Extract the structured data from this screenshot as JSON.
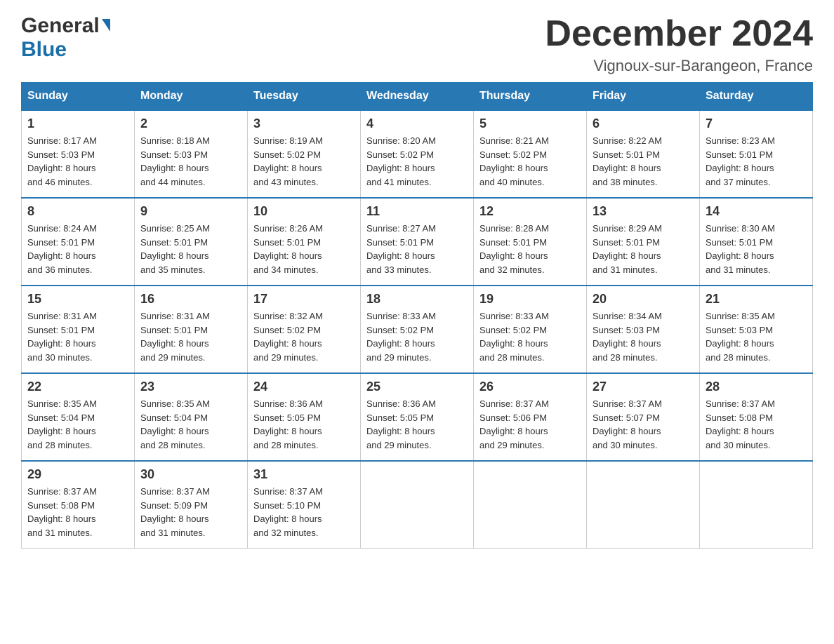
{
  "header": {
    "logo_general": "General",
    "logo_blue": "Blue",
    "month_title": "December 2024",
    "location": "Vignoux-sur-Barangeon, France"
  },
  "days_of_week": [
    "Sunday",
    "Monday",
    "Tuesday",
    "Wednesday",
    "Thursday",
    "Friday",
    "Saturday"
  ],
  "weeks": [
    [
      {
        "day": "1",
        "sunrise": "8:17 AM",
        "sunset": "5:03 PM",
        "daylight": "8 hours and 46 minutes."
      },
      {
        "day": "2",
        "sunrise": "8:18 AM",
        "sunset": "5:03 PM",
        "daylight": "8 hours and 44 minutes."
      },
      {
        "day": "3",
        "sunrise": "8:19 AM",
        "sunset": "5:02 PM",
        "daylight": "8 hours and 43 minutes."
      },
      {
        "day": "4",
        "sunrise": "8:20 AM",
        "sunset": "5:02 PM",
        "daylight": "8 hours and 41 minutes."
      },
      {
        "day": "5",
        "sunrise": "8:21 AM",
        "sunset": "5:02 PM",
        "daylight": "8 hours and 40 minutes."
      },
      {
        "day": "6",
        "sunrise": "8:22 AM",
        "sunset": "5:01 PM",
        "daylight": "8 hours and 38 minutes."
      },
      {
        "day": "7",
        "sunrise": "8:23 AM",
        "sunset": "5:01 PM",
        "daylight": "8 hours and 37 minutes."
      }
    ],
    [
      {
        "day": "8",
        "sunrise": "8:24 AM",
        "sunset": "5:01 PM",
        "daylight": "8 hours and 36 minutes."
      },
      {
        "day": "9",
        "sunrise": "8:25 AM",
        "sunset": "5:01 PM",
        "daylight": "8 hours and 35 minutes."
      },
      {
        "day": "10",
        "sunrise": "8:26 AM",
        "sunset": "5:01 PM",
        "daylight": "8 hours and 34 minutes."
      },
      {
        "day": "11",
        "sunrise": "8:27 AM",
        "sunset": "5:01 PM",
        "daylight": "8 hours and 33 minutes."
      },
      {
        "day": "12",
        "sunrise": "8:28 AM",
        "sunset": "5:01 PM",
        "daylight": "8 hours and 32 minutes."
      },
      {
        "day": "13",
        "sunrise": "8:29 AM",
        "sunset": "5:01 PM",
        "daylight": "8 hours and 31 minutes."
      },
      {
        "day": "14",
        "sunrise": "8:30 AM",
        "sunset": "5:01 PM",
        "daylight": "8 hours and 31 minutes."
      }
    ],
    [
      {
        "day": "15",
        "sunrise": "8:31 AM",
        "sunset": "5:01 PM",
        "daylight": "8 hours and 30 minutes."
      },
      {
        "day": "16",
        "sunrise": "8:31 AM",
        "sunset": "5:01 PM",
        "daylight": "8 hours and 29 minutes."
      },
      {
        "day": "17",
        "sunrise": "8:32 AM",
        "sunset": "5:02 PM",
        "daylight": "8 hours and 29 minutes."
      },
      {
        "day": "18",
        "sunrise": "8:33 AM",
        "sunset": "5:02 PM",
        "daylight": "8 hours and 29 minutes."
      },
      {
        "day": "19",
        "sunrise": "8:33 AM",
        "sunset": "5:02 PM",
        "daylight": "8 hours and 28 minutes."
      },
      {
        "day": "20",
        "sunrise": "8:34 AM",
        "sunset": "5:03 PM",
        "daylight": "8 hours and 28 minutes."
      },
      {
        "day": "21",
        "sunrise": "8:35 AM",
        "sunset": "5:03 PM",
        "daylight": "8 hours and 28 minutes."
      }
    ],
    [
      {
        "day": "22",
        "sunrise": "8:35 AM",
        "sunset": "5:04 PM",
        "daylight": "8 hours and 28 minutes."
      },
      {
        "day": "23",
        "sunrise": "8:35 AM",
        "sunset": "5:04 PM",
        "daylight": "8 hours and 28 minutes."
      },
      {
        "day": "24",
        "sunrise": "8:36 AM",
        "sunset": "5:05 PM",
        "daylight": "8 hours and 28 minutes."
      },
      {
        "day": "25",
        "sunrise": "8:36 AM",
        "sunset": "5:05 PM",
        "daylight": "8 hours and 29 minutes."
      },
      {
        "day": "26",
        "sunrise": "8:37 AM",
        "sunset": "5:06 PM",
        "daylight": "8 hours and 29 minutes."
      },
      {
        "day": "27",
        "sunrise": "8:37 AM",
        "sunset": "5:07 PM",
        "daylight": "8 hours and 30 minutes."
      },
      {
        "day": "28",
        "sunrise": "8:37 AM",
        "sunset": "5:08 PM",
        "daylight": "8 hours and 30 minutes."
      }
    ],
    [
      {
        "day": "29",
        "sunrise": "8:37 AM",
        "sunset": "5:08 PM",
        "daylight": "8 hours and 31 minutes."
      },
      {
        "day": "30",
        "sunrise": "8:37 AM",
        "sunset": "5:09 PM",
        "daylight": "8 hours and 31 minutes."
      },
      {
        "day": "31",
        "sunrise": "8:37 AM",
        "sunset": "5:10 PM",
        "daylight": "8 hours and 32 minutes."
      },
      null,
      null,
      null,
      null
    ]
  ],
  "labels": {
    "sunrise": "Sunrise:",
    "sunset": "Sunset:",
    "daylight": "Daylight:"
  }
}
